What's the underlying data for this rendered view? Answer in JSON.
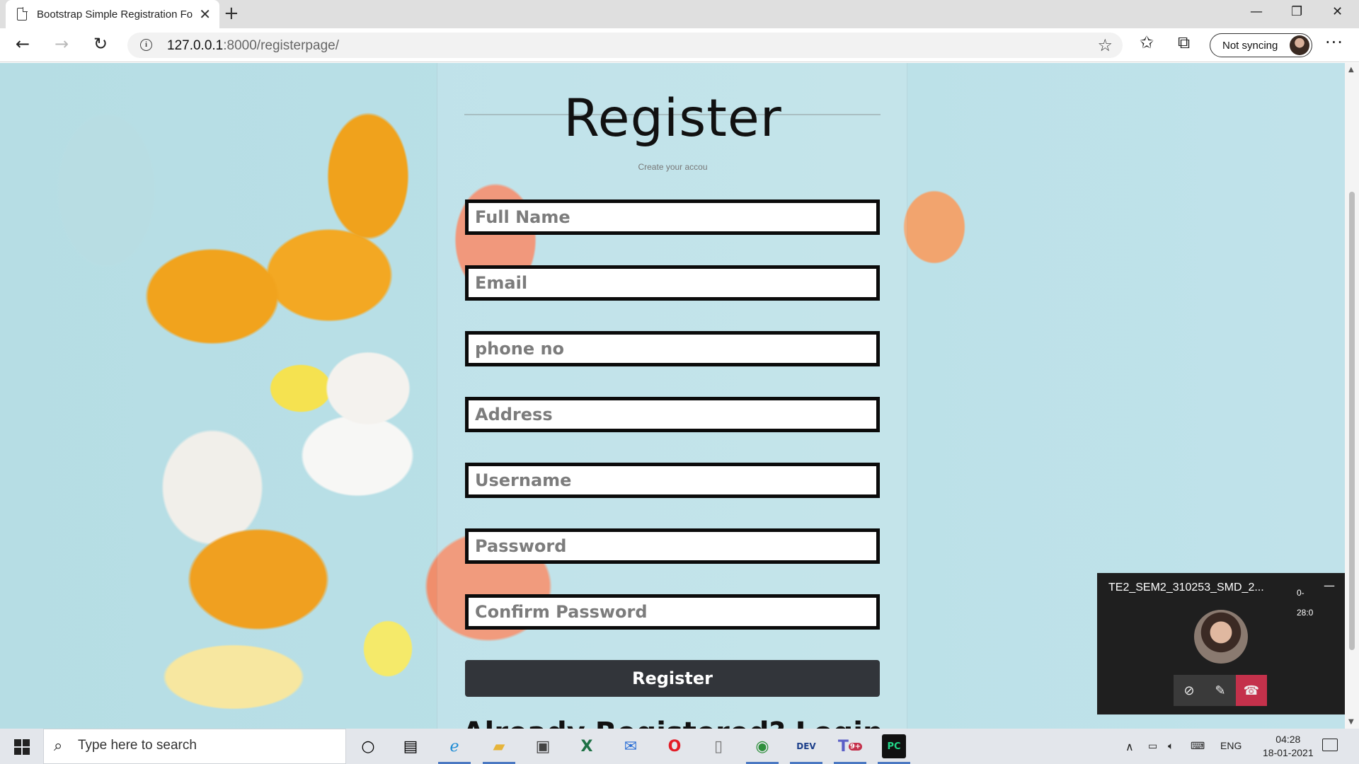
{
  "browser": {
    "tab_title": "Bootstrap Simple Registration Fo",
    "url_host": "127.0.0.1",
    "url_rest": ":8000/registerpage/",
    "sync_label": "Not syncing"
  },
  "page": {
    "title": "Register",
    "subtitle": "Create your accou",
    "fields": [
      {
        "placeholder": "Full Name",
        "type": "text"
      },
      {
        "placeholder": "Email",
        "type": "email"
      },
      {
        "placeholder": "phone no",
        "type": "text"
      },
      {
        "placeholder": "Address",
        "type": "text"
      },
      {
        "placeholder": "Username",
        "type": "text"
      },
      {
        "placeholder": "Password",
        "type": "password"
      },
      {
        "placeholder": "Confirm Password",
        "type": "password"
      }
    ],
    "register_button": "Register",
    "signin_text": "Already Registered? Login"
  },
  "teams": {
    "meeting_title": "TE2_SEM2_310253_SMD_2...",
    "elapsed": "0-\n28:0"
  },
  "taskbar": {
    "search_placeholder": "Type here to search",
    "language": "ENG",
    "time": "04:28",
    "date": "18-01-2021",
    "apps": [
      "cortana-icon",
      "task-view-icon",
      "edge-icon",
      "file-explorer-icon",
      "store-icon",
      "excel-icon",
      "mail-icon",
      "opera-icon",
      "notepad-icon",
      "chrome-icon",
      "dev-c-icon",
      "teams-icon",
      "pycharm-icon"
    ],
    "teams_badge": "9+"
  },
  "colors": {
    "page_bg": "#b9e0e7",
    "field_border": "#0b0b0b",
    "button_bg": "#32353a",
    "teams_bg": "#1f1f1f",
    "hangup": "#c4314b"
  }
}
